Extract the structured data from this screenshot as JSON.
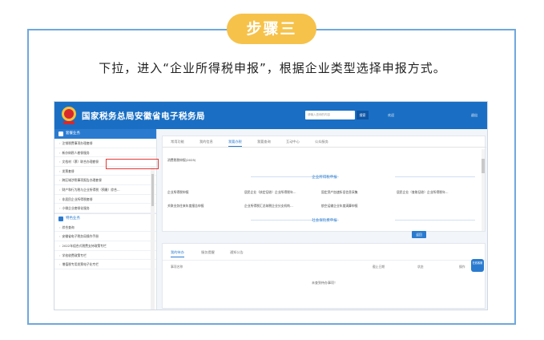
{
  "step": {
    "label": "步骤三"
  },
  "instruction": "下拉，进入“企业所得税申报”，根据企业类型选择申报方式。",
  "portal": {
    "site_title": "国家税务总局安徽省电子税务局",
    "search_placeholder": "请输入查询的内容",
    "search_button": "搜索",
    "user_text": "欢迎",
    "logout": "退出"
  },
  "sidebar": {
    "group1_title": "套餐业务",
    "group1_items": [
      "注销税费事项办理套餐",
      "新办纳税人套餐服务",
      "文档材（票）联合办理套餐",
      "发票套餐",
      "跨区域涉税事项报告办理套餐",
      "财产和行为税与企业所得税（预缴）综合…",
      "非居民企业所得税套餐",
      "小微企业套餐化服务"
    ],
    "group2_title": "特色业务",
    "group2_items": [
      "综合查询",
      "安徽省电子税务局操作手册",
      "2022年组合式税费支持政策专栏",
      "学校收费政策专栏",
      "增值税专用发票电子化专栏"
    ]
  },
  "main": {
    "tabs": [
      "常用功能",
      "我的信息",
      "我要办税",
      "我要查询",
      "互动中心",
      "公众服务"
    ],
    "active_tab_index": 2,
    "top_item": "消费税税申报(2025)",
    "section1_title": "企业所得税申报",
    "row1": [
      "企业所得税申报",
      "居民企业（核定征收）企业所得税年…",
      "固定资产加速折旧信息采集",
      "居民企业（查账征收）企业所得税年…"
    ],
    "row2": [
      "关联业务往来年度报告申报",
      "企业所得税汇总纳税企业分支机构…",
      "航空运输企业年度清算申报"
    ],
    "section2_title": "社会保险费申报",
    "back_button": "返回"
  },
  "bottom": {
    "tabs": [
      "我的待办",
      "服务提醒",
      "通知公告"
    ],
    "active_tab_index": 0,
    "columns": [
      "事项名称",
      "截止日期",
      "状态",
      "操作"
    ],
    "empty_message": "未查到待办事项！",
    "side_badge": "在线客服"
  },
  "colors": {
    "step_pill": "#f6c24a",
    "frame_border": "#6fa8dc",
    "portal_header": "#1a6fc4",
    "highlight_box": "#e53935"
  }
}
